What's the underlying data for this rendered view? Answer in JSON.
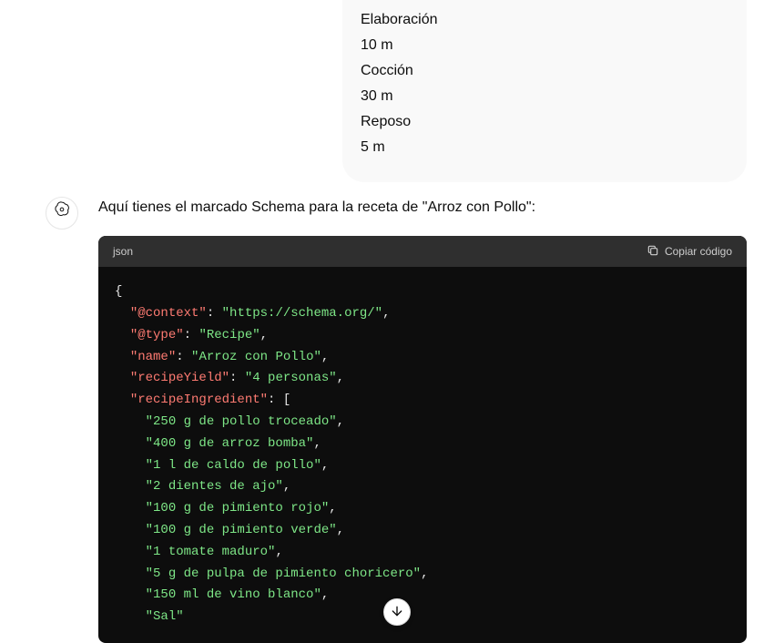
{
  "recipe_card": {
    "prep_label": "Elaboración",
    "prep_value": "10 m",
    "cook_label": "Cocción",
    "cook_value": "30 m",
    "rest_label": "Reposo",
    "rest_value": "5 m"
  },
  "assistant": {
    "intro": "Aquí tienes el marcado Schema para la receta de \"Arroz con Pollo\":"
  },
  "code": {
    "language": "json",
    "copy_label": "Copiar código",
    "json": {
      "context_key": "\"@context\"",
      "context_val": "\"https://schema.org/\"",
      "type_key": "\"@type\"",
      "type_val": "\"Recipe\"",
      "name_key": "\"name\"",
      "name_val": "\"Arroz con Pollo\"",
      "yield_key": "\"recipeYield\"",
      "yield_val": "\"4 personas\"",
      "ing_key": "\"recipeIngredient\"",
      "ingredients": [
        "\"250 g de pollo troceado\"",
        "\"400 g de arroz bomba\"",
        "\"1 l de caldo de pollo\"",
        "\"2 dientes de ajo\"",
        "\"100 g de pimiento rojo\"",
        "\"100 g de pimiento verde\"",
        "\"1 tomate maduro\"",
        "\"5 g de pulpa de pimiento choricero\"",
        "\"150 ml de vino blanco\"",
        "\"Sal\""
      ]
    }
  }
}
